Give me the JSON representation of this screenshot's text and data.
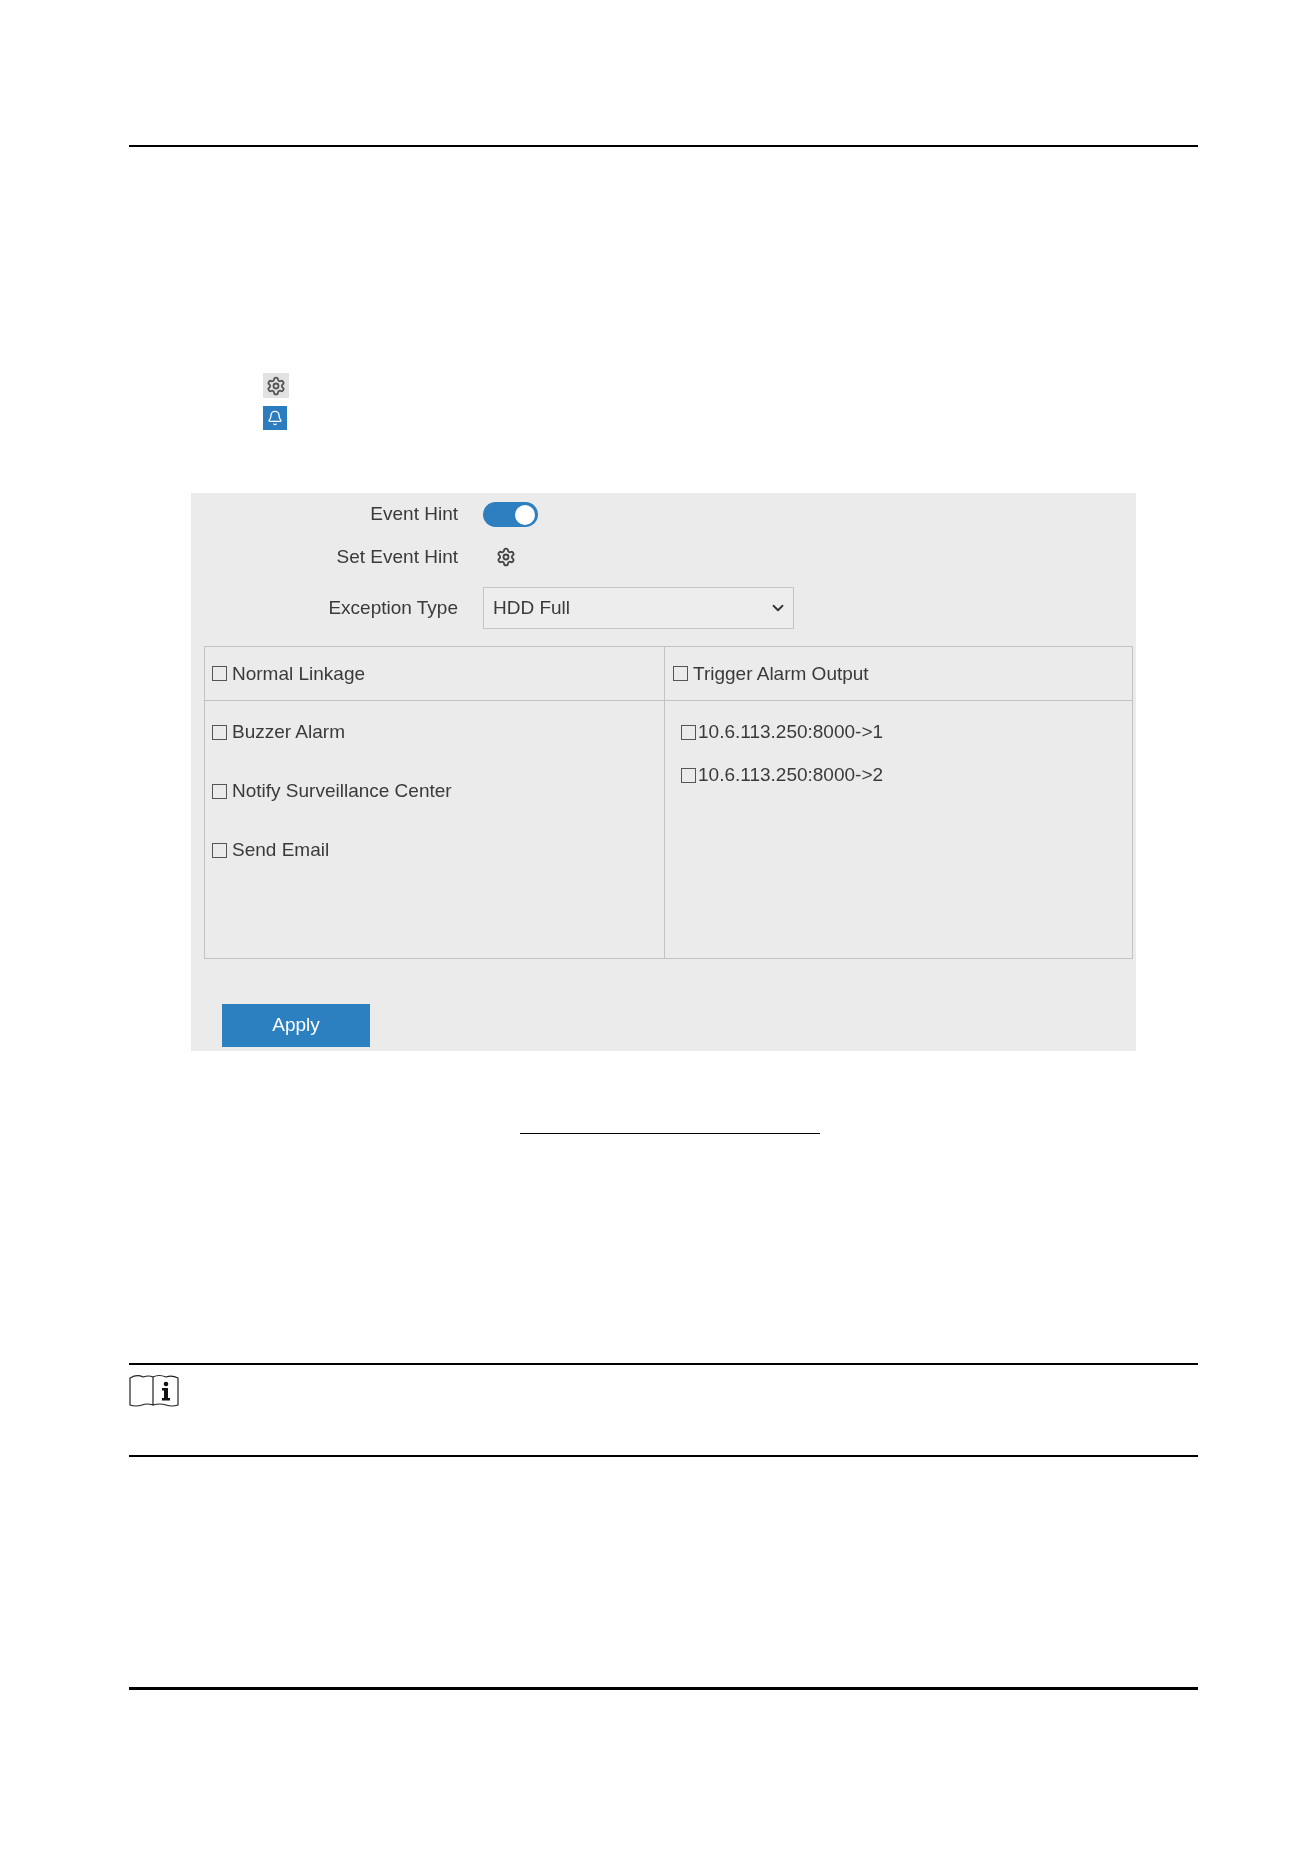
{
  "panel": {
    "fields": [
      {
        "kind": "toggle",
        "label": "Event Hint",
        "on": true
      },
      {
        "kind": "settings",
        "label": "Set Event Hint"
      },
      {
        "kind": "dropdown",
        "label": "Exception Type",
        "value": "HDD Full"
      }
    ],
    "linkage": {
      "columns": [
        {
          "header": {
            "label": "Normal Linkage",
            "checked": false
          },
          "items": [
            {
              "label": "Buzzer Alarm",
              "checked": false
            },
            {
              "label": "Notify Surveillance Center",
              "checked": false
            },
            {
              "label": "Send Email",
              "checked": false
            }
          ]
        },
        {
          "header": {
            "label": "Trigger Alarm Output",
            "checked": false
          },
          "items": [
            {
              "label": "10.6.113.250:8000->1",
              "checked": false
            },
            {
              "label": "10.6.113.250:8000->2",
              "checked": false
            }
          ]
        }
      ]
    },
    "buttons": [
      {
        "label": "Apply"
      }
    ]
  }
}
